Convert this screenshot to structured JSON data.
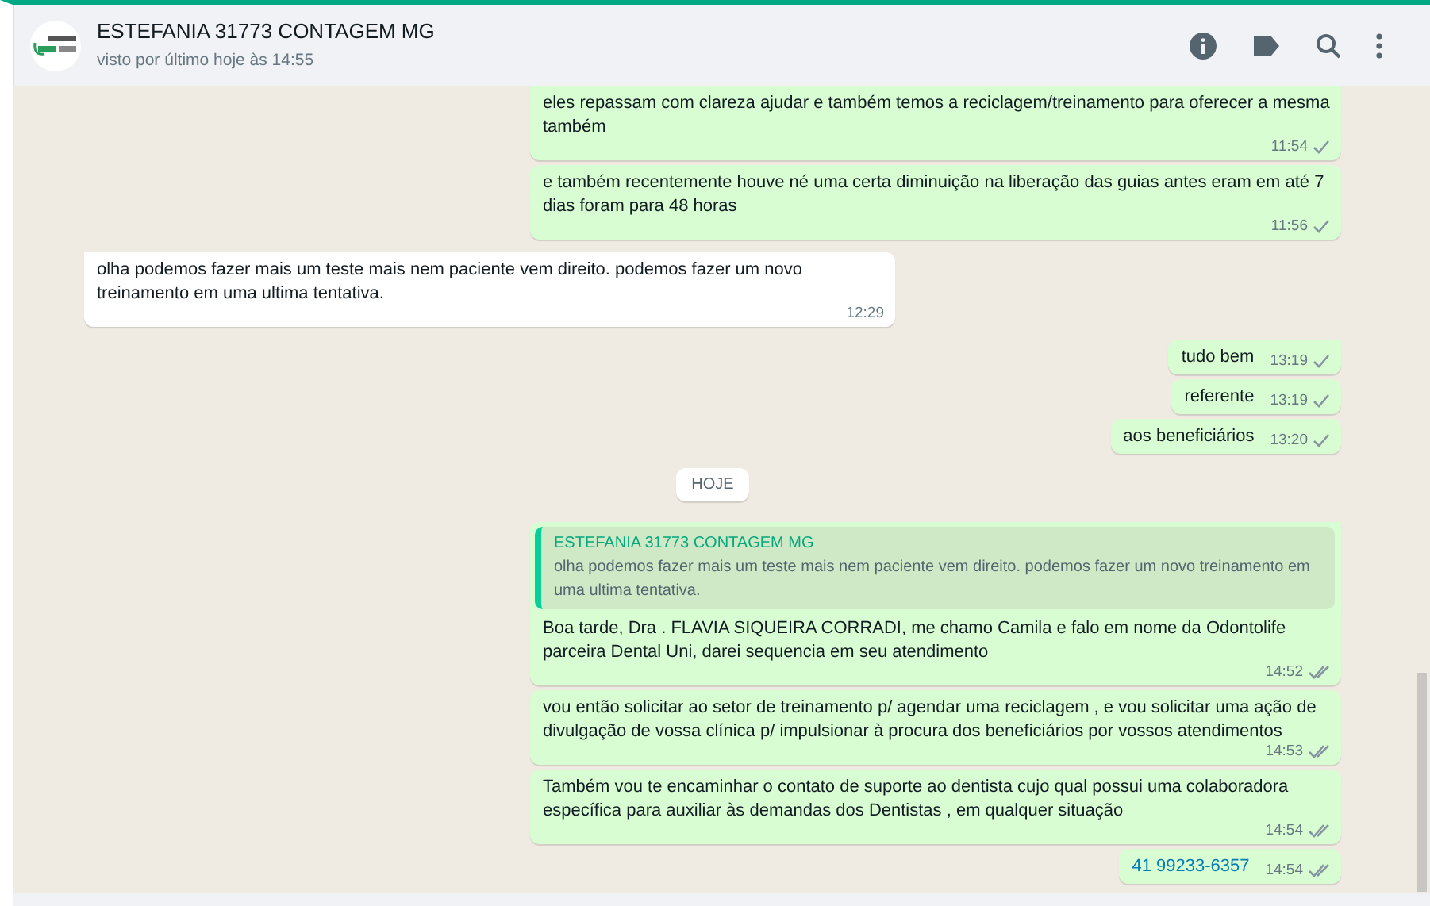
{
  "header": {
    "title": "ESTEFANIA 31773 CONTAGEM MG",
    "subtitle": "visto por último hoje às 14:55"
  },
  "messages": [
    {
      "kind": "out",
      "tail": false,
      "text": "eles repassam com clareza ajudar e também temos a reciclagem/treinamento para oferecer a mesma também",
      "time": "11:54",
      "delivered": false
    },
    {
      "kind": "out",
      "tail": false,
      "text": "e também recentemente houve né uma certa diminuição na liberação das guias antes eram em até 7 dias foram para 48 horas",
      "time": "11:56",
      "delivered": false
    },
    {
      "kind": "in",
      "tail": true,
      "text": "olha podemos fazer mais um teste mais nem paciente vem direito. podemos fazer um novo treinamento em uma ultima tentativa.",
      "time": "12:29"
    },
    {
      "kind": "out",
      "tail": true,
      "text": "tudo bem",
      "time": "13:19",
      "delivered": false
    },
    {
      "kind": "out",
      "tail": false,
      "text": "referente",
      "time": "13:19",
      "delivered": false
    },
    {
      "kind": "out",
      "tail": false,
      "text": "aos beneficiários",
      "time": "13:20",
      "delivered": false
    },
    {
      "kind": "date",
      "text": "HOJE"
    },
    {
      "kind": "out",
      "tail": true,
      "quote": {
        "author": "ESTEFANIA 31773 CONTAGEM MG",
        "text": "olha podemos fazer mais um teste mais nem paciente vem direito. podemos fazer um novo treinamento em uma ultima tentativa."
      },
      "text": "Boa tarde, Dra . FLAVIA SIQUEIRA CORRADI, me chamo Camila e falo em nome da Odontolife parceira Dental Uni, darei sequencia em seu atendimento",
      "time": "14:52",
      "delivered": true
    },
    {
      "kind": "out",
      "tail": false,
      "text": "vou então solicitar ao setor de treinamento p/ agendar uma reciclagem , e vou solicitar uma ação de divulgação de vossa clínica p/ impulsionar à procura dos beneficiários por vossos atendimentos",
      "time": "14:53",
      "delivered": true
    },
    {
      "kind": "out",
      "tail": false,
      "text": "Também vou te encaminhar o contato de suporte ao dentista cujo qual possui uma colaboradora específica para auxiliar às demandas dos Dentistas , em qualquer situação",
      "time": "14:54",
      "delivered": true
    },
    {
      "kind": "out",
      "tail": false,
      "link": true,
      "text": "41 99233-6357",
      "time": "14:54",
      "delivered": true
    }
  ]
}
